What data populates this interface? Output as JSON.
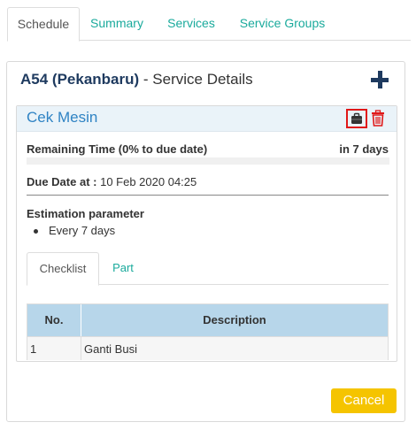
{
  "tabs": [
    {
      "label": "Schedule"
    },
    {
      "label": "Summary"
    },
    {
      "label": "Services"
    },
    {
      "label": "Service Groups"
    }
  ],
  "panel": {
    "code": "A54 (Pekanbaru)",
    "title_suffix": "- Service Details",
    "add_icon": "plus-icon"
  },
  "service": {
    "name": "Cek Mesin",
    "action_icons": [
      "briefcase-icon",
      "trash-icon"
    ],
    "remaining_label": "Remaining Time (0% to due date)",
    "remaining_value": "in 7 days",
    "remaining_progress": 0,
    "due_label": "Due Date at :",
    "due_value": "10 Feb 2020 04:25",
    "estimation_label": "Estimation parameter",
    "estimation_items": [
      "Every 7 days"
    ]
  },
  "subtabs": [
    {
      "label": "Checklist"
    },
    {
      "label": "Part"
    }
  ],
  "table": {
    "headers": [
      "No.",
      "Description"
    ],
    "rows": [
      [
        "1",
        "Ganti Busi"
      ]
    ]
  },
  "footer": {
    "cancel_label": "Cancel"
  },
  "colors": {
    "accent": "#1aaa9c",
    "title_blue": "#2f83c4",
    "cancel": "#f5c400",
    "danger": "#e01818"
  }
}
